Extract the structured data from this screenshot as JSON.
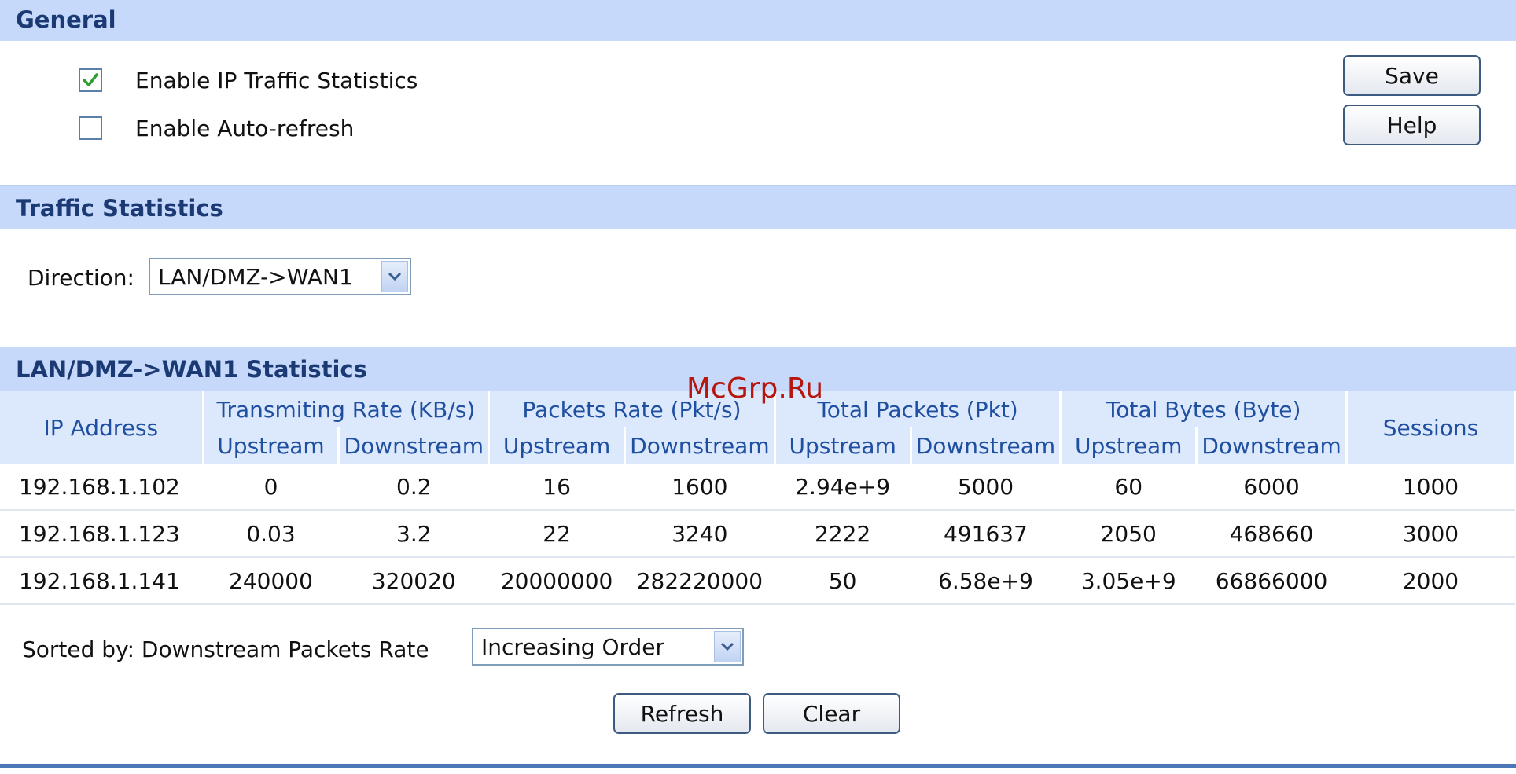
{
  "general": {
    "title": "General",
    "enable_ip_traffic_label": "Enable IP Traffic Statistics",
    "enable_ip_traffic_checked": true,
    "enable_auto_refresh_label": "Enable Auto-refresh",
    "enable_auto_refresh_checked": false,
    "save_label": "Save",
    "help_label": "Help"
  },
  "traffic": {
    "title": "Traffic Statistics",
    "direction_label": "Direction:",
    "direction_value": "LAN/DMZ->WAN1"
  },
  "stats": {
    "title": "LAN/DMZ->WAN1 Statistics",
    "headers": {
      "ip_address": "IP Address",
      "transmitting_rate": "Transmiting Rate (KB/s)",
      "packets_rate": "Packets Rate (Pkt/s)",
      "total_packets": "Total Packets (Pkt)",
      "total_bytes": "Total Bytes (Byte)",
      "sessions": "Sessions",
      "upstream": "Upstream",
      "downstream": "Downstream"
    },
    "rows": [
      {
        "ip": "192.168.1.102",
        "tr_up": "0",
        "tr_down": "0.2",
        "pr_up": "16",
        "pr_down": "1600",
        "tp_up": "2.94e+9",
        "tp_down": "5000",
        "tb_up": "60",
        "tb_down": "6000",
        "sessions": "1000"
      },
      {
        "ip": "192.168.1.123",
        "tr_up": "0.03",
        "tr_down": "3.2",
        "pr_up": "22",
        "pr_down": "3240",
        "tp_up": "2222",
        "tp_down": "491637",
        "tb_up": "2050",
        "tb_down": "468660",
        "sessions": "3000"
      },
      {
        "ip": "192.168.1.141",
        "tr_up": "240000",
        "tr_down": "320020",
        "pr_up": "20000000",
        "pr_down": "282220000",
        "tp_up": "50",
        "tp_down": "6.58e+9",
        "tb_up": "3.05e+9",
        "tb_down": "66866000",
        "sessions": "2000"
      }
    ]
  },
  "sort": {
    "label": "Sorted by: Downstream Packets Rate",
    "order_value": "Increasing Order"
  },
  "actions": {
    "refresh_label": "Refresh",
    "clear_label": "Clear"
  },
  "watermark": "McGrp.Ru",
  "colors": {
    "header_bg": "#c6d9fb",
    "header_text": "#1b3a73",
    "table_header_bg": "#dce8fc",
    "table_header_text": "#1f4fa0",
    "check_color": "#2e9e2e"
  }
}
